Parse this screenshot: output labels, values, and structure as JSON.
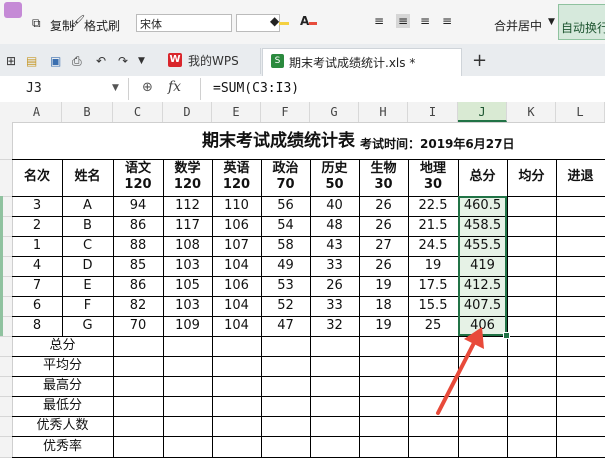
{
  "ribbon": {
    "copy_label": "复制",
    "format_painter_label": "格式刷",
    "font_name": "宋体",
    "merge_center_label": "合并居中",
    "auto_wrap_label": "自动换行"
  },
  "tabs": {
    "wps_label": "我的WPS",
    "file_label": "期末考试成绩统计.xls *",
    "add_label": "+"
  },
  "formula_bar": {
    "cell_ref": "J3",
    "fx_label": "fx",
    "formula": "=SUM(C3:I3)"
  },
  "columns": [
    "A",
    "B",
    "C",
    "D",
    "E",
    "F",
    "G",
    "H",
    "I",
    "J",
    "K",
    "L"
  ],
  "sheet": {
    "title": "期末考试成绩统计表",
    "exam_time": "考试时间：2019年6月27日",
    "headers": [
      {
        "top": "名次",
        "bottom": ""
      },
      {
        "top": "姓名",
        "bottom": ""
      },
      {
        "top": "语文",
        "bottom": "120"
      },
      {
        "top": "数学",
        "bottom": "120"
      },
      {
        "top": "英语",
        "bottom": "120"
      },
      {
        "top": "政治",
        "bottom": "70"
      },
      {
        "top": "历史",
        "bottom": "50"
      },
      {
        "top": "生物",
        "bottom": "30"
      },
      {
        "top": "地理",
        "bottom": "30"
      },
      {
        "top": "总分",
        "bottom": ""
      },
      {
        "top": "均分",
        "bottom": ""
      },
      {
        "top": "进退",
        "bottom": ""
      }
    ],
    "rows": [
      [
        "3",
        "A",
        "94",
        "112",
        "110",
        "56",
        "40",
        "26",
        "22.5",
        "460.5",
        "",
        ""
      ],
      [
        "2",
        "B",
        "86",
        "117",
        "106",
        "54",
        "48",
        "26",
        "21.5",
        "458.5",
        "",
        ""
      ],
      [
        "1",
        "C",
        "88",
        "108",
        "107",
        "58",
        "43",
        "27",
        "24.5",
        "455.5",
        "",
        ""
      ],
      [
        "4",
        "D",
        "85",
        "103",
        "104",
        "49",
        "33",
        "26",
        "19",
        "419",
        "",
        ""
      ],
      [
        "7",
        "E",
        "86",
        "105",
        "106",
        "53",
        "26",
        "19",
        "17.5",
        "412.5",
        "",
        ""
      ],
      [
        "6",
        "F",
        "82",
        "103",
        "104",
        "52",
        "33",
        "18",
        "15.5",
        "407.5",
        "",
        ""
      ],
      [
        "8",
        "G",
        "70",
        "109",
        "104",
        "47",
        "32",
        "19",
        "25",
        "406",
        "",
        ""
      ]
    ],
    "summary_labels": [
      "总分",
      "平均分",
      "最高分",
      "最低分",
      "优秀人数",
      "优秀率"
    ]
  },
  "colors": {
    "selection": "#217346",
    "arrow": "#e84a3a",
    "wps_red": "#d9262c"
  }
}
